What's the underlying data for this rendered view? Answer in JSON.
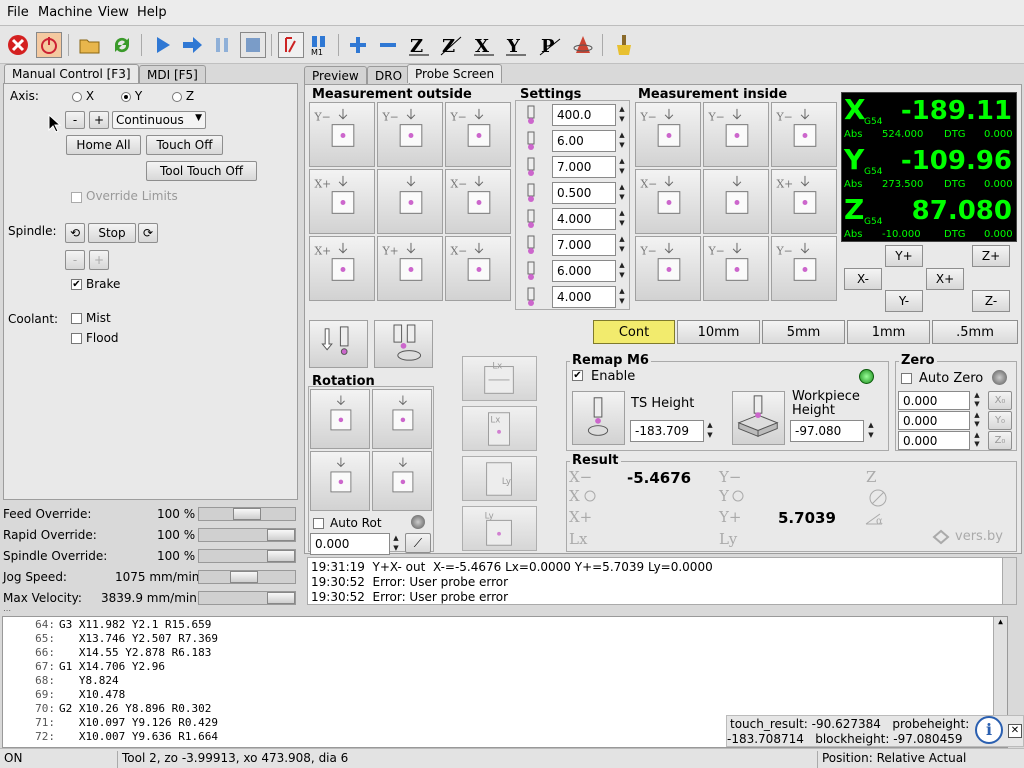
{
  "menu": [
    "File",
    "Machine",
    "View",
    "Help"
  ],
  "toolbar_icons": [
    "estop-icon",
    "power-icon",
    "open-icon",
    "reload-icon",
    "run-icon",
    "step-icon",
    "pause-icon",
    "stop-icon",
    "block-delete-icon",
    "optional-stop-icon",
    "zoom-in-icon",
    "zoom-out-icon",
    "view-z-icon",
    "view-z2-icon",
    "view-x-icon",
    "view-y-icon",
    "view-p-icon",
    "rotate-view-icon",
    "clear-plot-icon"
  ],
  "left_tabs": [
    "Manual Control [F3]",
    "MDI [F5]"
  ],
  "manual": {
    "axis_label": "Axis:",
    "axes": [
      "X",
      "Y",
      "Z"
    ],
    "selected_axis": "Y",
    "minus": "-",
    "plus": "+",
    "jog_mode": "Continuous",
    "home_all": "Home All",
    "touch_off": "Touch Off",
    "tool_touch_off": "Tool Touch Off",
    "override_limits": "Override Limits",
    "spindle_label": "Spindle:",
    "stop": "Stop",
    "brake": "Brake",
    "coolant_label": "Coolant:",
    "mist": "Mist",
    "flood": "Flood"
  },
  "overrides": [
    {
      "label": "Feed Override:",
      "value": "100 %",
      "level": 0.5
    },
    {
      "label": "Rapid Override:",
      "value": "100 %",
      "level": 1.0
    },
    {
      "label": "Spindle Override:",
      "value": "100 %",
      "level": 1.0
    },
    {
      "label": "Jog Speed:",
      "value": "1075 mm/min",
      "level": 0.45
    },
    {
      "label": "Max Velocity:",
      "value": "3839.9 mm/min",
      "level": 1.0
    }
  ],
  "right_tabs": [
    "Preview",
    "DRO",
    "Probe Screen"
  ],
  "probe": {
    "outside_title": "Measurement outside",
    "settings_title": "Settings",
    "inside_title": "Measurement inside",
    "settings_values": [
      "400.0",
      "6.00",
      "7.000",
      "0.500",
      "4.000",
      "7.000",
      "6.000",
      "4.000"
    ],
    "rotation_title": "Rotation",
    "auto_rot": "Auto Rot",
    "rot_value": "0.000",
    "steps": [
      "Cont",
      "10mm",
      "5mm",
      "1mm",
      ".5mm"
    ],
    "active_step": "Cont",
    "remap_title": "Remap M6",
    "enable": "Enable",
    "ts_height_label": "TS Height",
    "ts_height": "-183.709",
    "workpiece_label": "Workpiece Height",
    "workpiece_height": "-97.080",
    "zero_title": "Zero",
    "auto_zero": "Auto Zero",
    "zero_values": [
      "0.000",
      "0.000",
      "0.000"
    ],
    "result_title": "Result",
    "result_xminus": "-5.4676",
    "result_yplus": "5.7039",
    "watermark": "vers.by"
  },
  "dro": {
    "x": {
      "axis": "X",
      "sub": "G54",
      "value": "-189.11",
      "abs": "524.000",
      "dtg": "0.000"
    },
    "y": {
      "axis": "Y",
      "sub": "G54",
      "value": "-109.96",
      "abs": "273.500",
      "dtg": "0.000"
    },
    "z": {
      "axis": "Z",
      "sub": "G54",
      "value": "87.080",
      "abs": "-10.000",
      "dtg": "0.000"
    },
    "abs_label": "Abs",
    "dtg_label": "DTG"
  },
  "jog_buttons": {
    "yplus": "Y+",
    "zplus": "Z+",
    "xminus": "X-",
    "xplus": "X+",
    "yminus": "Y-",
    "zminus": "Z-"
  },
  "messages": [
    "19:31:19  Y+X- out  X-=-5.4676 Lx=0.0000 Y+=5.7039 Ly=0.0000",
    "19:30:52  Error: User probe error",
    "19:30:52  Error: User probe error"
  ],
  "gcode": [
    {
      "n": "64:",
      "t": "G3 X11.982 Y2.1 R15.659"
    },
    {
      "n": "65:",
      "t": "   X13.746 Y2.507 R7.369"
    },
    {
      "n": "66:",
      "t": "   X14.55 Y2.878 R6.183"
    },
    {
      "n": "67:",
      "t": "G1 X14.706 Y2.96"
    },
    {
      "n": "68:",
      "t": "   Y8.824"
    },
    {
      "n": "69:",
      "t": "   X10.478"
    },
    {
      "n": "70:",
      "t": "G2 X10.26 Y8.896 R0.302"
    },
    {
      "n": "71:",
      "t": "   X10.097 Y9.126 R0.429"
    },
    {
      "n": "72:",
      "t": "   X10.007 Y9.636 R1.664"
    }
  ],
  "tooltip": {
    "line1": "touch_result: -90.627384   probeheight:",
    "line2": "-183.708714   blockheight: -97.080459"
  },
  "status": {
    "state": "ON",
    "tool": "Tool 2, zo -3.99913, xo 473.908, dia 6",
    "position": "Position: Relative Actual"
  }
}
